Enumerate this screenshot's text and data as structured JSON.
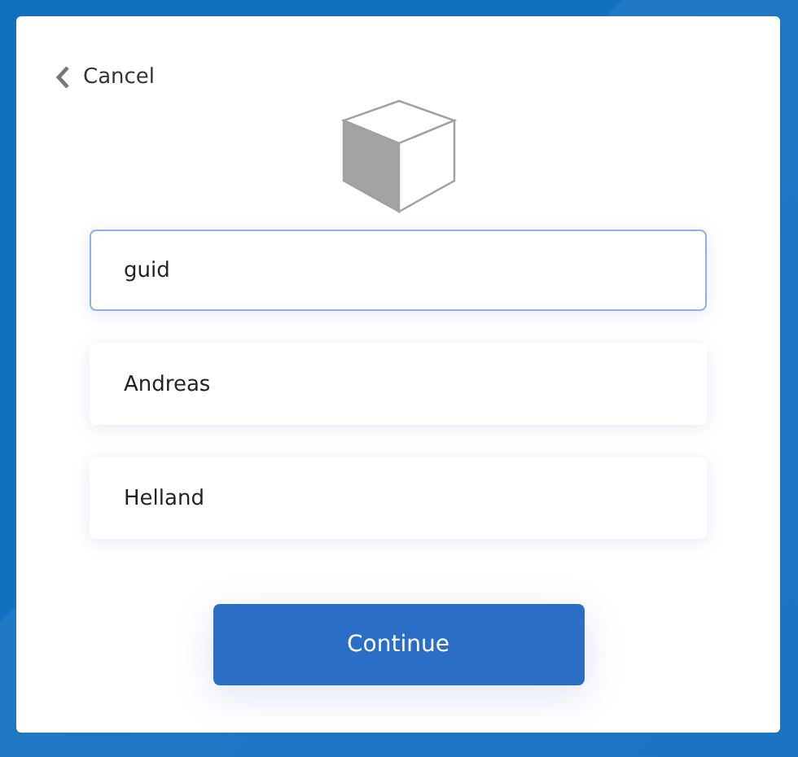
{
  "back_link": {
    "label": "Cancel"
  },
  "fields": [
    {
      "value": "guid",
      "focused": true
    },
    {
      "value": "Andreas",
      "focused": false
    },
    {
      "value": "Helland",
      "focused": false
    }
  ],
  "primary_button": {
    "label": "Continue"
  }
}
